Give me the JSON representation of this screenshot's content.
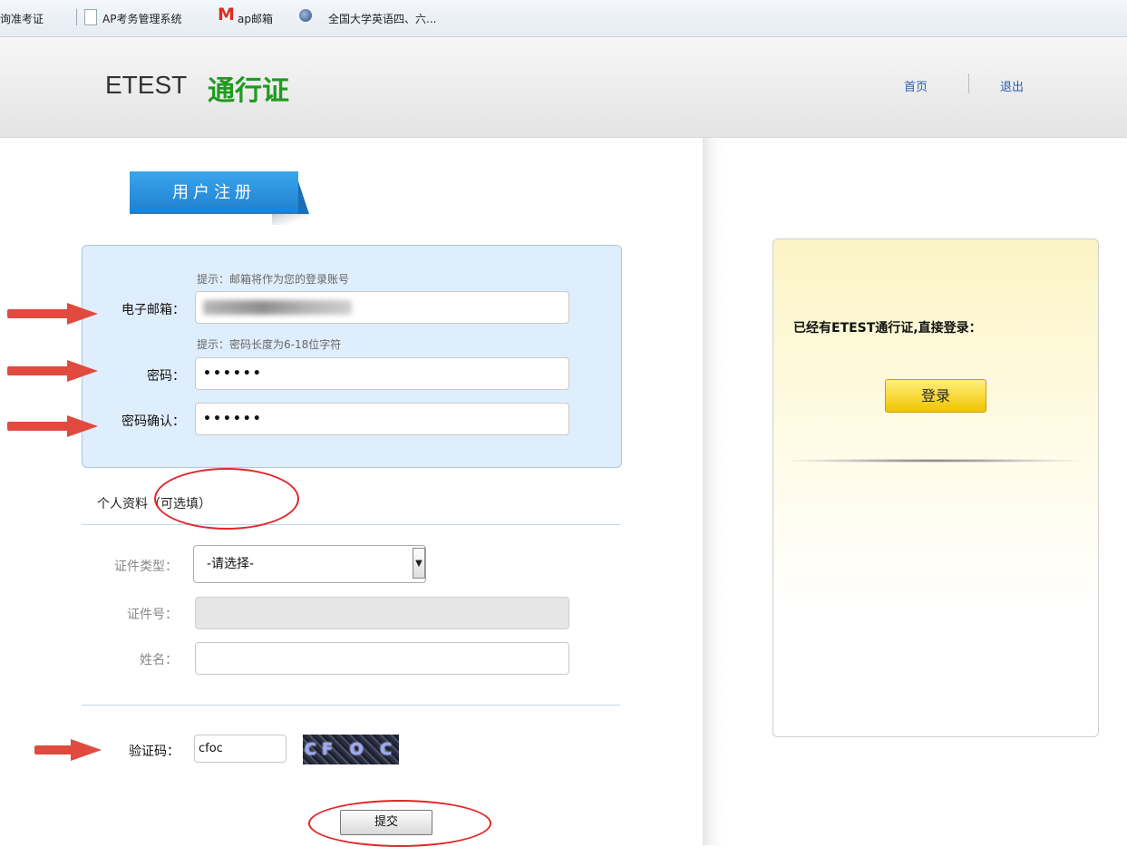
{
  "bookmarks": {
    "item1": "询准考证",
    "item2": "AP考务管理系统",
    "item3": "ap邮箱",
    "item4": "全国大学英语四、六..."
  },
  "header": {
    "logo_text": "ETEST",
    "logo_highlight": "通行证",
    "nav_home": "首页",
    "nav_logout": "退出"
  },
  "register": {
    "tab_label": "用户注册",
    "email_hint": "提示：邮箱将作为您的登录账号",
    "email_label": "电子邮箱：",
    "password_hint": "提示：密码长度为6-18位字符",
    "password_label": "密码：",
    "password_value": "••••••",
    "confirm_label": "密码确认：",
    "confirm_value": "••••••"
  },
  "optional": {
    "section_title": "个人资料（可选填）",
    "id_type_label": "证件类型：",
    "id_type_value": "-请选择-",
    "id_number_label": "证件号：",
    "name_label": "姓名：",
    "captcha_label": "验证码：",
    "captcha_value": "cfoc",
    "captcha_image_text": "CF O C",
    "submit_label": "提交"
  },
  "login": {
    "prompt": "已经有ETEST通行证,直接登录：",
    "button_label": "登录"
  },
  "colors": {
    "tab_blue": "#1e7fcf",
    "required_bg": "#dfeefc",
    "logo_green": "#1f9a1f",
    "annotation_red": "#e04a3f",
    "login_yellow": "#f0c400"
  }
}
